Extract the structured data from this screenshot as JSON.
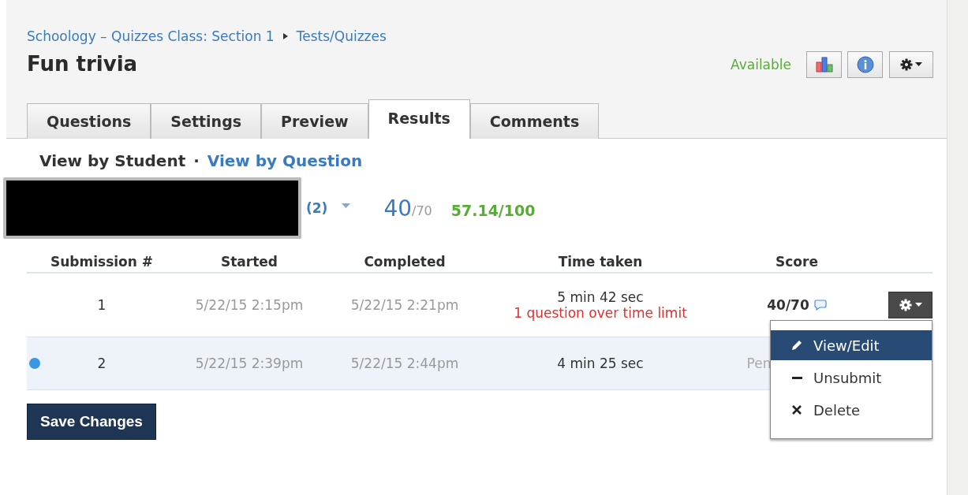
{
  "breadcrumb": [
    {
      "label": "Schoology – Quizzes Class: Section 1"
    },
    {
      "label": "Tests/Quizzes"
    }
  ],
  "title": "Fun trivia",
  "status": "Available",
  "tabs": [
    {
      "label": "Questions",
      "selected": false
    },
    {
      "label": "Settings",
      "selected": false
    },
    {
      "label": "Preview",
      "selected": false
    },
    {
      "label": "Results",
      "selected": true
    },
    {
      "label": "Comments",
      "selected": false
    }
  ],
  "view_toggle": {
    "options": [
      {
        "label": "View by Student",
        "selected": true
      },
      {
        "label": "View by Question",
        "selected": false
      }
    ],
    "separator": "·"
  },
  "student": {
    "attempts": "(2)",
    "score": "40",
    "total": "/70",
    "percent": "57.14/100"
  },
  "table": {
    "columns": [
      "Submission #",
      "Started",
      "Completed",
      "Time taken",
      "Score"
    ],
    "rows": [
      {
        "unread": false,
        "submission": "1",
        "started": "5/22/15 2:15pm",
        "completed": "5/22/15 2:21pm",
        "time_taken": "5 min 42 sec",
        "note": "1 question over time limit",
        "score": "40/70",
        "graded": true,
        "comment": true,
        "menu_open": true
      },
      {
        "unread": true,
        "submission": "2",
        "started": "5/22/15 2:39pm",
        "completed": "5/22/15 2:44pm",
        "time_taken": "4 min 25 sec",
        "score": "Pen",
        "graded": false,
        "comment": false,
        "menu_open": false
      }
    ]
  },
  "action_menu": [
    {
      "kind": "edit",
      "label": "View/Edit",
      "selected": true
    },
    {
      "kind": "unsubmit",
      "label": "Unsubmit",
      "selected": false
    },
    {
      "kind": "delete",
      "label": "Delete",
      "selected": false
    }
  ],
  "save_button": "Save Changes"
}
